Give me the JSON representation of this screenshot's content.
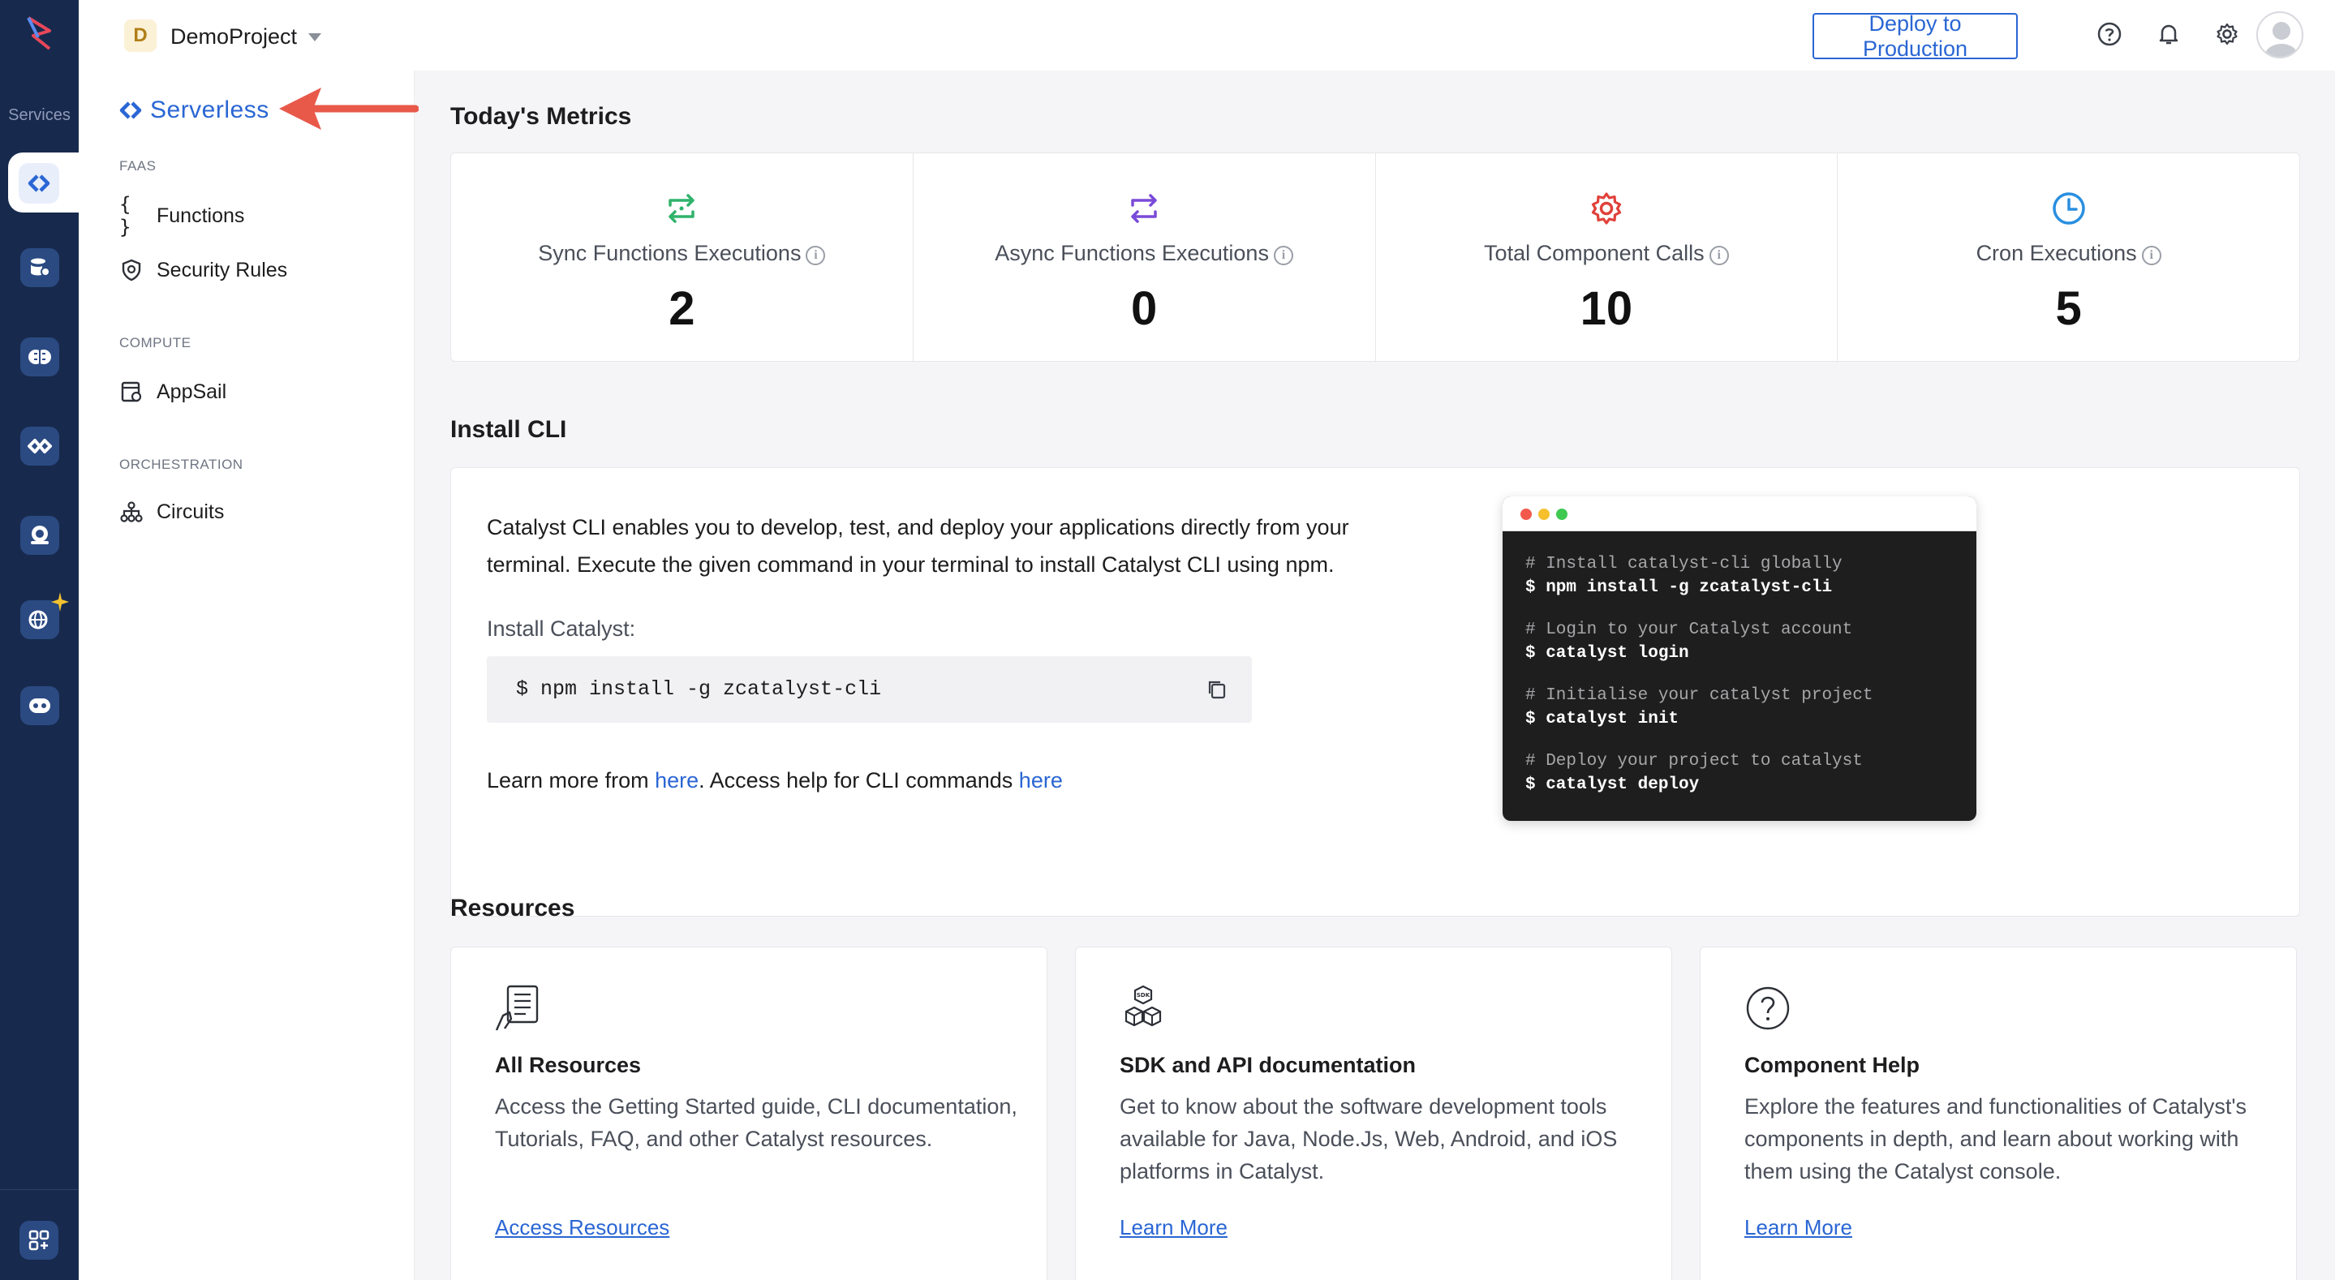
{
  "rail": {
    "services_label": "Services"
  },
  "topbar": {
    "project_initial": "D",
    "project_name": "DemoProject",
    "deploy_label": "Deploy to Production"
  },
  "subnav": {
    "title": "Serverless",
    "sections": [
      {
        "label": "FAAS",
        "items": [
          {
            "label": "Functions",
            "icon": "braces-icon"
          },
          {
            "label": "Security Rules",
            "icon": "shield-icon"
          }
        ]
      },
      {
        "label": "COMPUTE",
        "items": [
          {
            "label": "AppSail",
            "icon": "appsail-icon"
          }
        ]
      },
      {
        "label": "ORCHESTRATION",
        "items": [
          {
            "label": "Circuits",
            "icon": "circuits-icon"
          }
        ]
      }
    ]
  },
  "metrics": {
    "title": "Today's Metrics",
    "items": [
      {
        "label": "Sync Functions Executions",
        "value": "2",
        "icon": "sync-icon",
        "color": "#2fb36b"
      },
      {
        "label": "Async Functions Executions",
        "value": "0",
        "icon": "async-icon",
        "color": "#7a4bd8"
      },
      {
        "label": "Total Component Calls",
        "value": "10",
        "icon": "gear-icon",
        "color": "#e0413a"
      },
      {
        "label": "Cron Executions",
        "value": "5",
        "icon": "clock-icon",
        "color": "#2a8fe0"
      }
    ]
  },
  "cli": {
    "title": "Install CLI",
    "description": "Catalyst CLI enables you to develop, test, and deploy your applications directly from your terminal. Execute the given command in your terminal to install Catalyst CLI using npm.",
    "install_label": "Install Catalyst:",
    "command": "$ npm install -g zcatalyst-cli",
    "learn_prefix": "Learn more from ",
    "learn_link": "here",
    "help_text": ". Access help for CLI commands ",
    "help_link": "here",
    "terminal": [
      {
        "comment": "# Install catalyst-cli globally",
        "command": "$ npm install -g zcatalyst-cli"
      },
      {
        "comment": "# Login to your Catalyst account",
        "command": "$ catalyst login"
      },
      {
        "comment": "# Initialise your catalyst project",
        "command": "$ catalyst init"
      },
      {
        "comment": "# Deploy your project to catalyst",
        "command": "$ catalyst deploy"
      }
    ]
  },
  "resources": {
    "title": "Resources",
    "cards": [
      {
        "title": "All Resources",
        "description": "Access the Getting Started guide, CLI documentation, Tutorials, FAQ, and other Catalyst resources.",
        "link": "Access Resources",
        "icon": "document-hand-icon"
      },
      {
        "title": "SDK and API documentation",
        "description": "Get to know about the software development tools available for Java, Node.Js, Web, Android, and iOS platforms in Catalyst.",
        "link": "Learn More",
        "icon": "sdk-cubes-icon"
      },
      {
        "title": "Component Help",
        "description": "Explore the features and functionalities of Catalyst's components in depth, and learn about working with them using the Catalyst console.",
        "link": "Learn More",
        "icon": "question-circle-icon"
      }
    ]
  },
  "colors": {
    "accent": "#2a66d4",
    "rail": "#172a4d",
    "annotation_arrow": "#e8594a"
  }
}
